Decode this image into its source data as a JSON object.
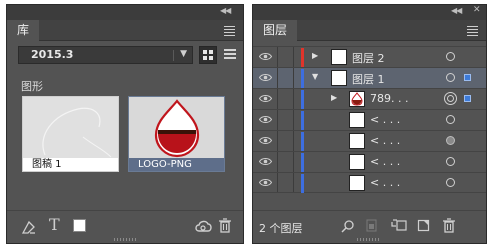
{
  "library_panel": {
    "tab_label": "库",
    "library_name": "2015.3",
    "section_label": "图形",
    "items": [
      {
        "label": "图稿 1"
      },
      {
        "label": "LOGO-PNG"
      }
    ],
    "footer_text_icon": "T"
  },
  "layers_panel": {
    "tab_label": "图层",
    "rows": [
      {
        "name": "图层 2",
        "color": "#e0342b",
        "expand": "▶",
        "selected": false
      },
      {
        "name": "图层 1",
        "color": "#3d6ee0",
        "expand": "▼",
        "selected": true
      },
      {
        "name": "789. . .",
        "color": "#3d6ee0",
        "expand": "▶",
        "selected": false
      },
      {
        "name": "< . . .",
        "color": "#3d6ee0",
        "expand": "",
        "selected": false
      },
      {
        "name": "< . . .",
        "color": "#3d6ee0",
        "expand": "",
        "selected": false
      },
      {
        "name": "< . . .",
        "color": "#3d6ee0",
        "expand": "",
        "selected": false
      },
      {
        "name": "< . . .",
        "color": "#3d6ee0",
        "expand": "",
        "selected": false
      }
    ],
    "layer_count": "2 个图层"
  },
  "colors": {
    "panel_bg": "#535353",
    "selected_row": "#5d6470",
    "accent_blue": "#3d7bd9",
    "layer2_red": "#e0342b"
  }
}
